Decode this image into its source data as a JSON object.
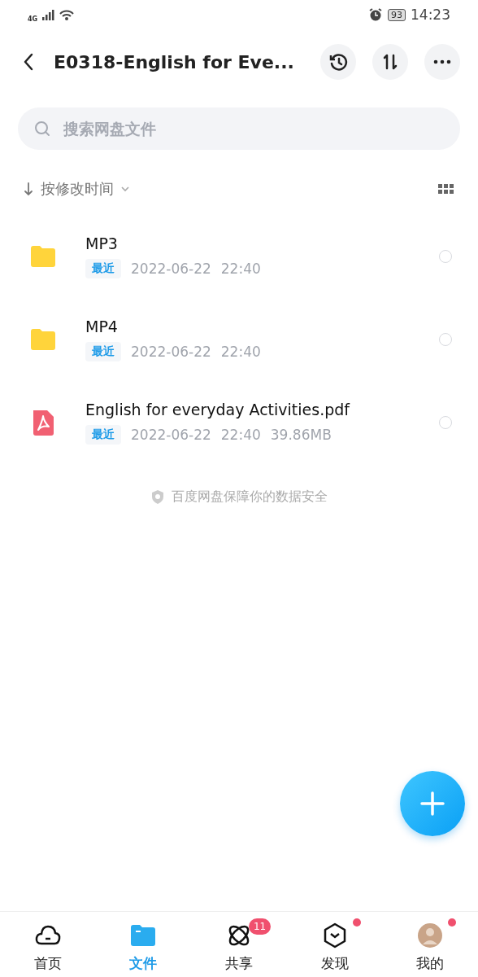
{
  "status_bar": {
    "network": "4G",
    "battery": "93",
    "time": "14:23"
  },
  "header": {
    "title": "E0318-English for Eve..."
  },
  "search": {
    "placeholder": "搜索网盘文件"
  },
  "sort": {
    "label": "按修改时间"
  },
  "files": [
    {
      "kind": "folder",
      "name": "MP3",
      "tag": "最近",
      "date": "2022-06-22",
      "time": "22:40",
      "selected": false
    },
    {
      "kind": "folder",
      "name": "MP4",
      "tag": "最近",
      "date": "2022-06-22",
      "time": "22:40",
      "selected": false
    },
    {
      "kind": "pdf",
      "name": "English for everyday Activities.pdf",
      "tag": "最近",
      "date": "2022-06-22",
      "time": "22:40",
      "size": "39.86MB",
      "selected": false
    }
  ],
  "footer_note": "百度网盘保障你的数据安全",
  "nav": [
    {
      "kind": "home",
      "label": "首页",
      "selected": false
    },
    {
      "kind": "files",
      "label": "文件",
      "selected": true
    },
    {
      "kind": "share",
      "label": "共享",
      "selected": false,
      "badge": "11"
    },
    {
      "kind": "discover",
      "label": "发现",
      "selected": false,
      "dot": true
    },
    {
      "kind": "me",
      "label": "我的",
      "selected": false,
      "dot": true
    }
  ]
}
